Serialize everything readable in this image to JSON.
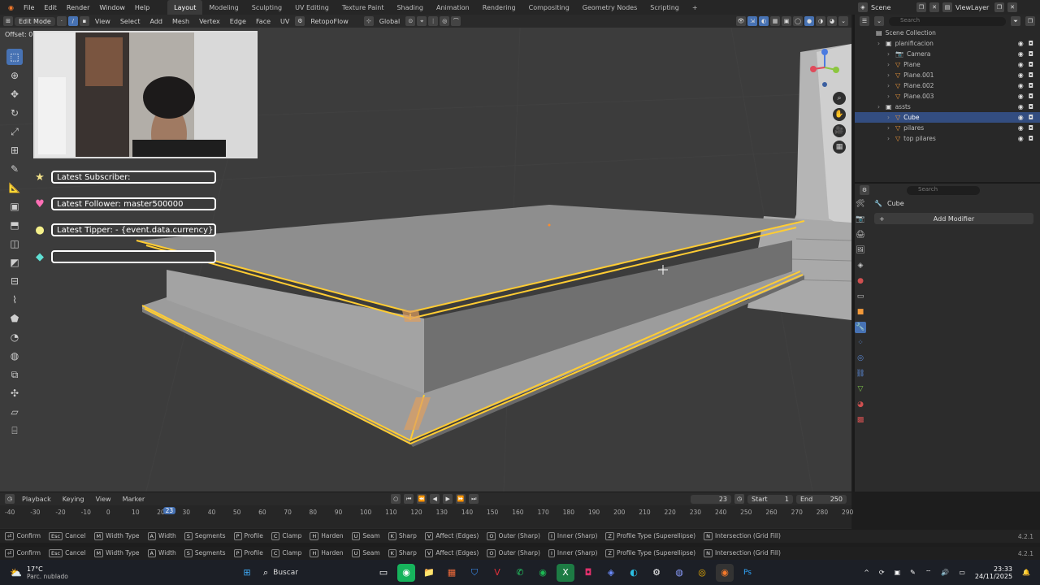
{
  "menubar": {
    "menus": [
      "File",
      "Edit",
      "Render",
      "Window",
      "Help"
    ],
    "workspaces": [
      "Layout",
      "Modeling",
      "Sculpting",
      "UV Editing",
      "Texture Paint",
      "Shading",
      "Animation",
      "Rendering",
      "Compositing",
      "Geometry Nodes",
      "Scripting"
    ],
    "active_workspace": "Layout",
    "scene": "Scene",
    "view_layer": "ViewLayer"
  },
  "header3d": {
    "mode": "Edit Mode",
    "menus": [
      "View",
      "Select",
      "Add",
      "Mesh",
      "Vertex",
      "Edge",
      "Face",
      "UV"
    ],
    "addon": "RetopoFlow",
    "orientation": "Global"
  },
  "viewport": {
    "offset_label": "Offset: 0.",
    "overlay": {
      "subscriber": "Latest Subscriber:",
      "follower": "Latest Follower: master500000",
      "tipper": "Latest Tipper:  - {event.data.currency} 0",
      "empty": ""
    }
  },
  "outliner": {
    "search_placeholder": "Search",
    "rows": [
      {
        "label": "Scene Collection",
        "indent": 0,
        "sel": false
      },
      {
        "label": "planificacion",
        "indent": 1,
        "sel": false
      },
      {
        "label": "Camera",
        "indent": 2,
        "sel": false
      },
      {
        "label": "Plane",
        "indent": 2,
        "sel": false
      },
      {
        "label": "Plane.001",
        "indent": 2,
        "sel": false
      },
      {
        "label": "Plane.002",
        "indent": 2,
        "sel": false
      },
      {
        "label": "Plane.003",
        "indent": 2,
        "sel": false
      },
      {
        "label": "assts",
        "indent": 1,
        "sel": false
      },
      {
        "label": "Cube",
        "indent": 2,
        "sel": true
      },
      {
        "label": "pilares",
        "indent": 2,
        "sel": false
      },
      {
        "label": "top pilares",
        "indent": 2,
        "sel": false
      }
    ]
  },
  "properties": {
    "search_placeholder": "Search",
    "object_name": "Cube",
    "add_modifier": "Add Modifier"
  },
  "timeline": {
    "menus": [
      "Playback",
      "Keying",
      "View",
      "Marker"
    ],
    "current_frame": "23",
    "start_label": "Start",
    "start": "1",
    "end_label": "End",
    "end": "250",
    "ticks": [
      "-40",
      "-30",
      "-20",
      "-10",
      "0",
      "10",
      "20",
      "30",
      "40",
      "50",
      "60",
      "70",
      "80",
      "90",
      "100",
      "110",
      "120",
      "130",
      "140",
      "150",
      "160",
      "170",
      "180",
      "190",
      "200",
      "210",
      "220",
      "230",
      "240",
      "250",
      "260",
      "270",
      "280",
      "290"
    ]
  },
  "status": {
    "items": [
      {
        "key": "⏎",
        "label": "Confirm"
      },
      {
        "key": "Esc",
        "label": "Cancel"
      },
      {
        "key": "M",
        "label": "Width Type"
      },
      {
        "key": "A",
        "label": "Width"
      },
      {
        "key": "S",
        "label": "Segments"
      },
      {
        "key": "P",
        "label": "Profile"
      },
      {
        "key": "C",
        "label": "Clamp"
      },
      {
        "key": "H",
        "label": "Harden"
      },
      {
        "key": "U",
        "label": "Seam"
      },
      {
        "key": "K",
        "label": "Sharp"
      },
      {
        "key": "V",
        "label": "Affect (Edges)"
      },
      {
        "key": "O",
        "label": "Outer (Sharp)"
      },
      {
        "key": "I",
        "label": "Inner (Sharp)"
      },
      {
        "key": "Z",
        "label": "Profile Type (Superellipse)"
      },
      {
        "key": "N",
        "label": "Intersection (Grid Fill)"
      }
    ],
    "version": "4.2.1"
  },
  "taskbar": {
    "weather_temp": "17°C",
    "weather_desc": "Parc. nublado",
    "search": "Buscar",
    "time": "23:33",
    "date": "24/11/2025"
  },
  "colors": {
    "accent": "#4772b3",
    "selection_edge": "#ffcc33",
    "mesh_top": "#8e8e8e",
    "viewport_bg": "#3c3c3c"
  }
}
